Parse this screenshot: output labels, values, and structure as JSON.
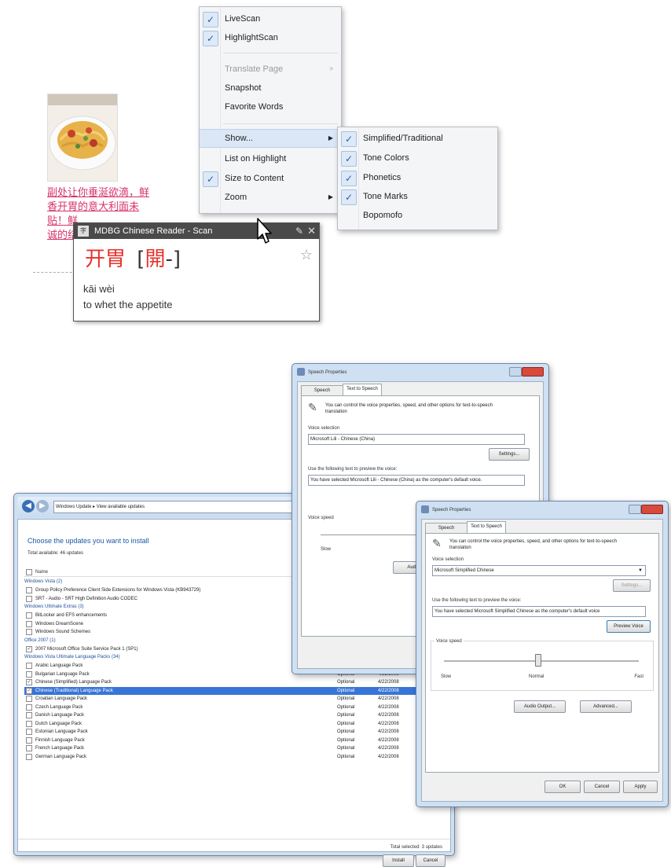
{
  "context_menu": {
    "items": [
      {
        "label": "LiveScan",
        "checked": true
      },
      {
        "label": "HighlightScan",
        "checked": true
      },
      {
        "label": "Translate Page",
        "disabled": true,
        "submenu": true
      },
      {
        "label": "Snapshot"
      },
      {
        "label": "Favorite Words"
      },
      {
        "label": "Show...",
        "submenu": true,
        "highlighted": true
      },
      {
        "label": "List on Highlight"
      },
      {
        "label": "Size to Content",
        "checked": true
      },
      {
        "label": "Zoom",
        "submenu": true
      }
    ],
    "submenu_show": [
      {
        "label": "Simplified/Traditional",
        "checked": true
      },
      {
        "label": "Tone Colors",
        "checked": true
      },
      {
        "label": "Phonetics",
        "checked": true
      },
      {
        "label": "Tone Marks",
        "checked": true
      },
      {
        "label": "Bopomofo",
        "checked": false
      }
    ]
  },
  "article": {
    "lines": [
      "副处让你垂涎欲滴，鲜",
      "香开胃的意大利面未",
      "贴！鲜",
      "诚的结"
    ]
  },
  "reader_popup": {
    "title": "MDBG Chinese Reader - Scan",
    "word_simplified": "开胃",
    "bracket_open": "[",
    "word_traditional": "開",
    "dash": "-",
    "bracket_close": "]",
    "pinyin": "kāi wèi",
    "definition": "to whet the appetite",
    "colors": {
      "tone1": "#e8332b",
      "tone4": "#1f3fd6"
    }
  },
  "windows_update": {
    "address": [
      "Windows Update",
      "View available updates"
    ],
    "heading": "Choose the updates you want to install",
    "subheading": "Total available: 46 updates",
    "column_name": "Name",
    "groups": [
      {
        "label": "Windows Vista (2)",
        "rows": [
          {
            "name": "Group Policy Preference Client Side Extensions for Windows Vista (KB943729)",
            "checked": false
          },
          {
            "name": "SRT - Audio - SRT High Definition Audio CODEC",
            "checked": false
          }
        ]
      },
      {
        "label": "Windows Ultimate Extras (3)",
        "rows": [
          {
            "name": "BitLocker and EFS enhancements",
            "checked": false
          },
          {
            "name": "Windows DreamScene",
            "checked": false
          },
          {
            "name": "Windows Sound Schemes",
            "checked": false
          }
        ]
      },
      {
        "label": "Office 2007 (1)",
        "rows": [
          {
            "name": "2007 Microsoft Office Suite Service Pack 1 (SP1)",
            "checked": true
          }
        ]
      },
      {
        "label": "Windows Vista Ultimate Language Packs (34)",
        "rows": [
          {
            "name": "Arabic Language Pack",
            "type": "Optional",
            "date": "4/22/2008",
            "checked": false
          },
          {
            "name": "Bulgarian Language Pack",
            "type": "Optional",
            "date": "4/22/2008",
            "checked": false
          },
          {
            "name": "Chinese (Simplified) Language Pack",
            "type": "Optional",
            "date": "4/22/2008",
            "checked": true
          },
          {
            "name": "Chinese (Traditional) Language Pack",
            "type": "Optional",
            "date": "4/22/2008",
            "checked": true,
            "selected": true
          },
          {
            "name": "Croatian Language Pack",
            "type": "Optional",
            "date": "4/22/2008",
            "checked": false
          },
          {
            "name": "Czech Language Pack",
            "type": "Optional",
            "date": "4/22/2008",
            "checked": false
          },
          {
            "name": "Danish Language Pack",
            "type": "Optional",
            "date": "4/22/2008",
            "checked": false
          },
          {
            "name": "Dutch Language Pack",
            "type": "Optional",
            "date": "4/22/2008",
            "checked": false
          },
          {
            "name": "Estonian Language Pack",
            "type": "Optional",
            "date": "4/22/2008",
            "checked": false
          },
          {
            "name": "Finnish Language Pack",
            "type": "Optional",
            "date": "4/22/2008",
            "checked": false
          },
          {
            "name": "French Language Pack",
            "type": "Optional",
            "date": "4/22/2008",
            "checked": false
          },
          {
            "name": "German Language Pack",
            "type": "Optional",
            "date": "4/22/2008",
            "checked": false
          }
        ]
      }
    ],
    "total_selected": "Total selected: 3 updates",
    "install_label": "Install",
    "cancel_label": "Cancel"
  },
  "speech_back": {
    "title": "Speech Properties",
    "tab1": "Speech Recognition",
    "tab2": "Text to Speech",
    "intro": "You can control the voice properties, speed, and other options for text-to-speech translation",
    "voice_selection_label": "Voice selection",
    "voice_value": "Microsoft Lili - Chinese (China)",
    "settings_label": "Settings...",
    "preview_label": "Use the following text to preview the voice:",
    "preview_text": "You have selected Microsoft Lili - Chinese (China) as the computer's default voice.",
    "voice_speed_label": "Voice speed",
    "slow_label": "Slow",
    "audio_label": "Audio"
  },
  "speech_front": {
    "title": "Speech Properties",
    "tab1": "Speech Recognition",
    "tab2": "Text to Speech",
    "intro": "You can control the voice properties, speed, and other options for text-to-speech translation",
    "voice_selection_label": "Voice selection",
    "voice_value": "Microsoft Simplified Chinese",
    "settings_label": "Settings...",
    "preview_label": "Use the following text to preview the voice:",
    "preview_text": "You have selected Microsoft Simplified Chinese as the computer's default voice",
    "preview_button": "Preview Voice",
    "voice_speed_label": "Voice speed",
    "slow_label": "Slow",
    "normal_label": "Normal",
    "fast_label": "Fast",
    "audio_output_label": "Audio Output...",
    "advanced_label": "Advanced...",
    "ok_label": "OK",
    "cancel_label": "Cancel",
    "apply_label": "Apply"
  }
}
